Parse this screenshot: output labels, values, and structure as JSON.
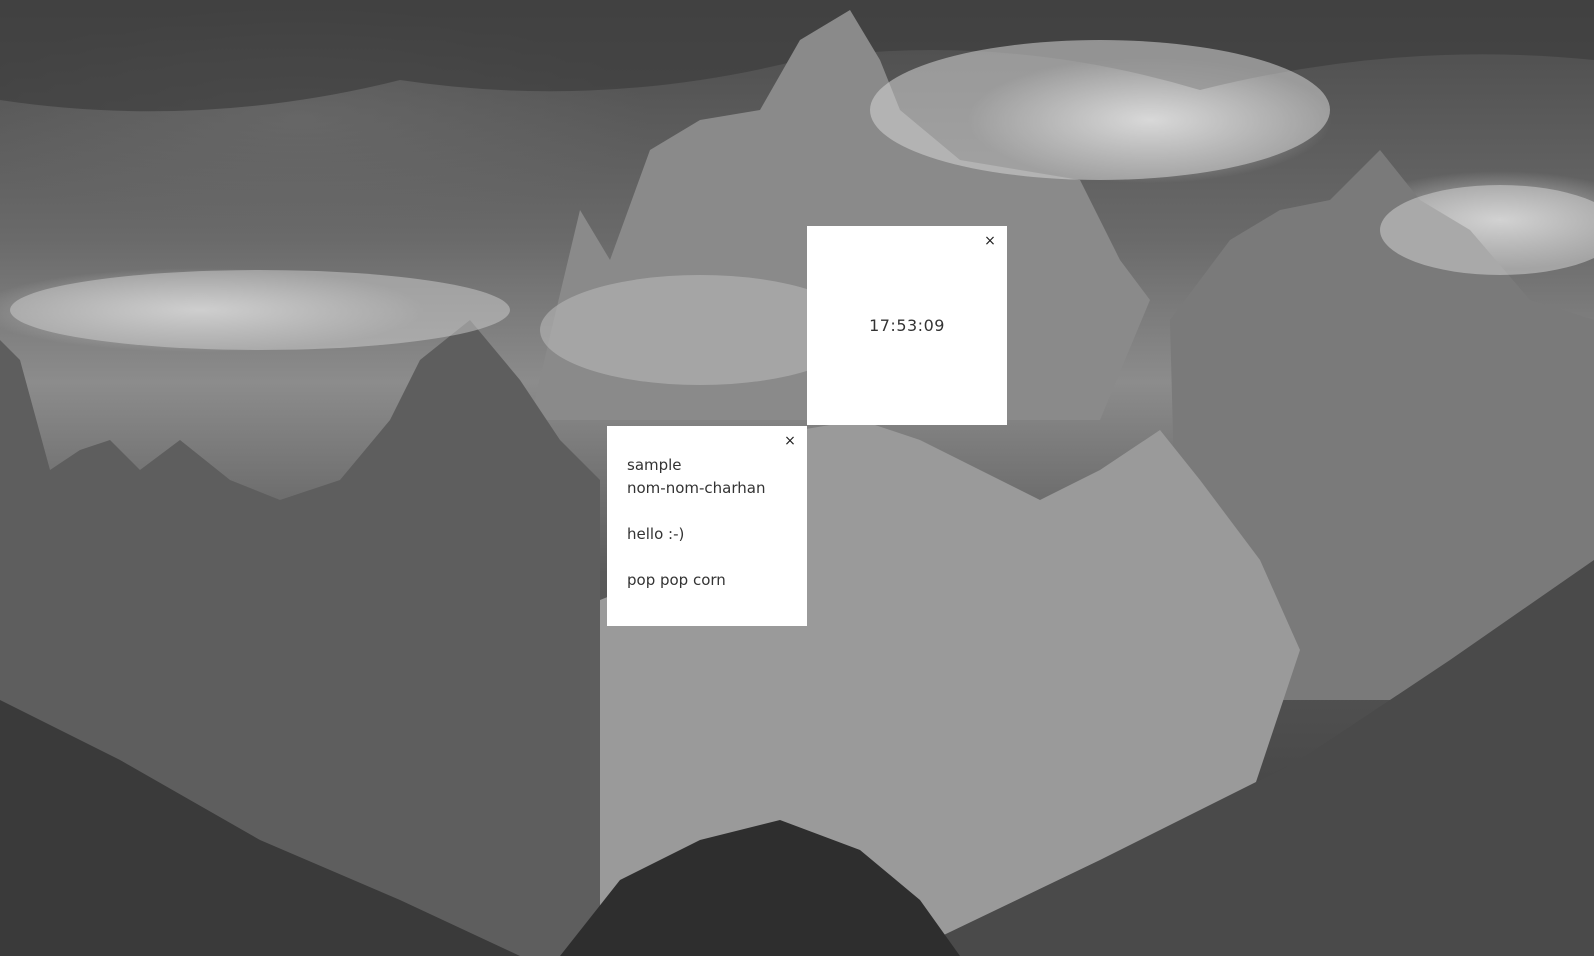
{
  "clock_widget": {
    "time": "17:53:09",
    "close_label": "×"
  },
  "note_widget": {
    "close_label": "×",
    "lines": [
      "sample",
      "nom-nom-charhan",
      "",
      "hello :-)",
      "",
      "pop pop corn"
    ]
  },
  "wallpaper": {
    "description_color": "#6a6a6a"
  }
}
